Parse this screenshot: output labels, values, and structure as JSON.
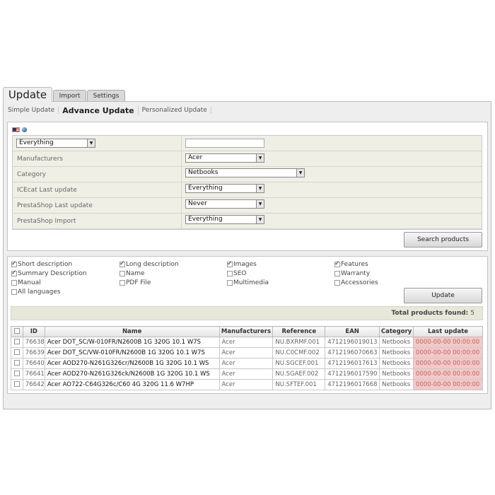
{
  "tabs": [
    {
      "label": "Update"
    },
    {
      "label": "Import"
    },
    {
      "label": "Settings"
    }
  ],
  "subtabs": [
    {
      "label": "Simple Update"
    },
    {
      "label": "Advance Update"
    },
    {
      "label": "Personalized Update"
    }
  ],
  "filters": {
    "everything_select": "Everything",
    "search_value": "",
    "rows": [
      {
        "label": "Manufacturers",
        "value": "Acer"
      },
      {
        "label": "Category",
        "value": "Netbooks"
      },
      {
        "label": "ICEcat Last update",
        "value": "Everything"
      },
      {
        "label": "PrestaShop Last update",
        "value": "Never"
      },
      {
        "label": "PrestaShop Import",
        "value": "Everything"
      }
    ],
    "search_button": "Search products"
  },
  "fields": [
    {
      "label": "Short description",
      "checked": true
    },
    {
      "label": "Long description",
      "checked": true
    },
    {
      "label": "Images",
      "checked": true
    },
    {
      "label": "Features",
      "checked": true
    },
    {
      "label": "Summary Description",
      "checked": true
    },
    {
      "label": "Name",
      "checked": false
    },
    {
      "label": "SEO",
      "checked": false
    },
    {
      "label": "Warranty",
      "checked": false
    },
    {
      "label": "Manual",
      "checked": false
    },
    {
      "label": "PDF File",
      "checked": false
    },
    {
      "label": "Multimedia",
      "checked": false
    },
    {
      "label": "Accessories",
      "checked": false
    },
    {
      "label": "All languages",
      "checked": false
    }
  ],
  "update_button": "Update",
  "total": {
    "label": "Total products found:",
    "value": "5"
  },
  "table": {
    "headers": [
      "ID",
      "Name",
      "Manufacturers",
      "Reference",
      "EAN",
      "Category",
      "Last update"
    ],
    "rows": [
      {
        "id": "76638",
        "name": "Acer DOT_SC/W-010FR/N2600B 1G 320G 10.1 W7S",
        "manufacturer": "Acer",
        "reference": "NU.BXRMF.001",
        "ean": "4712196019013",
        "category": "Netbooks",
        "last_update": "0000-00-00 00:00:00"
      },
      {
        "id": "76639",
        "name": "Acer DOT_SC/VW-010FR/N2600B 1G 320G 10.1 W7S",
        "manufacturer": "Acer",
        "reference": "NU.C0CMF.002",
        "ean": "4712196070663",
        "category": "Netbooks",
        "last_update": "0000-00-00 00:00:00"
      },
      {
        "id": "76640",
        "name": "Acer AOD270-N261G326cr/N2600B 1G 320G 10.1 WS",
        "manufacturer": "Acer",
        "reference": "NU.SGCEF.001",
        "ean": "4712196017613",
        "category": "Netbooks",
        "last_update": "0000-00-00 00:00:00"
      },
      {
        "id": "76641",
        "name": "Acer AOD270-N261G326ck/N2600B 1G 320G 10.1 WS",
        "manufacturer": "Acer",
        "reference": "NU.SGAEF.002",
        "ean": "4712196017590",
        "category": "Netbooks",
        "last_update": "0000-00-00 00:00:00"
      },
      {
        "id": "76642",
        "name": "Acer AO722-C64G326c/C60 4G 320G 11.6 W7HP",
        "manufacturer": "Acer",
        "reference": "NU.SFTEF.001",
        "ean": "4712196017668",
        "category": "Netbooks",
        "last_update": "0000-00-00 00:00:00"
      }
    ]
  }
}
